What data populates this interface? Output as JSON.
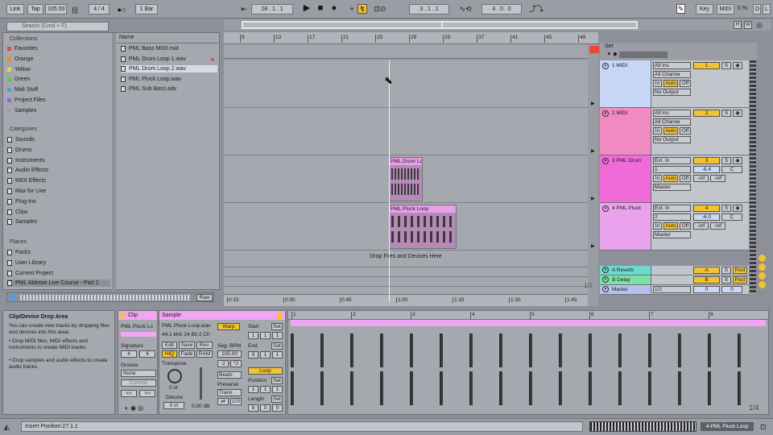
{
  "topbar": {
    "link": "Link",
    "tap": "Tap",
    "tempo": "105.00",
    "signature": "4 / 4",
    "quantize": "1 Bar",
    "arrangement_position": "28 . 1 . 1",
    "loop_start": "3 . 1 . 1",
    "loop_length": "4 . 0 . 0",
    "key": "Key",
    "midi": "MIDI",
    "cpu": "0 %",
    "disk_label": "D",
    "letter_l": "L"
  },
  "browser": {
    "search_placeholder": "Search (Cmd + F)",
    "collections_header": "Collections",
    "collections": [
      {
        "label": "Favorites",
        "color": "#e5484d"
      },
      {
        "label": "Orange",
        "color": "#f18a1e"
      },
      {
        "label": "Yellow",
        "color": "#f0d33b"
      },
      {
        "label": "Green",
        "color": "#5fc45c"
      },
      {
        "label": "Midi Stuff",
        "color": "#5a9be0"
      },
      {
        "label": "Project Files",
        "color": "#9a62d9"
      },
      {
        "label": "Samples",
        "color": "#9da0a8"
      }
    ],
    "categories_header": "Categories",
    "categories": [
      "Sounds",
      "Drums",
      "Instruments",
      "Audio Effects",
      "MIDI Effects",
      "Max for Live",
      "Plug-Ins",
      "Clips",
      "Samples"
    ],
    "places_header": "Places",
    "places": [
      "Packs",
      "User Library",
      "Current Project",
      "PML Ableton Live Course - Part 1"
    ],
    "name_header": "Name",
    "files": [
      "PML Bass MIDI.mid",
      "PML Drum Loop 1.wav",
      "PML Drum Loop 2.wav",
      "PML Pluck Loop.wav",
      "PML Sub Bass.adv"
    ],
    "raw": "Raw"
  },
  "arrangement": {
    "bar_numbers": [
      "9",
      "13",
      "17",
      "21",
      "25",
      "29",
      "33",
      "37",
      "41",
      "45",
      "49"
    ],
    "time_labels": [
      "0:15",
      "0:30",
      "0:45",
      "1:00",
      "1:15",
      "1:30",
      "1:45"
    ],
    "drop_text": "Drop Files and Devices Here",
    "zoom": "1/1",
    "set_label": "Set",
    "clips": [
      "PML Drum Lo",
      "PML Pluck Loop"
    ]
  },
  "tracks": [
    {
      "name": "1 MIDI",
      "color": "#c6d6f7",
      "input": "All Ins",
      "channel": "All Channe",
      "output": "No Output",
      "number": "1",
      "type": "midi"
    },
    {
      "name": "2 MIDI",
      "color": "#f08ac0",
      "input": "All Ins",
      "channel": "All Channe",
      "output": "No Output",
      "number": "2",
      "type": "midi"
    },
    {
      "name": "3 PML Drum",
      "color": "#f06ad8",
      "input": "Ext. In",
      "channel": "1",
      "output": "Master",
      "number": "3",
      "vol": "-6.4",
      "pan": "C",
      "peak1": "-inf",
      "peak2": "-inf",
      "type": "audio"
    },
    {
      "name": "4 PML Pluck",
      "color": "#e9a2ec",
      "input": "Ext. In",
      "channel": "2",
      "output": "Master",
      "number": "4",
      "vol": "-6.0",
      "pan": "C",
      "peak1": "-inf",
      "peak2": "-inf",
      "type": "audio"
    }
  ],
  "returns": [
    {
      "name": "A Reverb",
      "color": "#6fd8cf",
      "letter": "A",
      "post": "Post"
    },
    {
      "name": "B Delay",
      "color": "#7ee0a5",
      "letter": "B",
      "post": "Post"
    },
    {
      "name": "Master",
      "color": "#b6c0f0",
      "output": "1/2",
      "value": "0",
      "value2": "0"
    }
  ],
  "io": {
    "in": "In",
    "auto": "Auto",
    "off": "Off",
    "s": "S"
  },
  "info": {
    "title": "Clip/Device Drop Area",
    "text": "You can create new tracks by dropping files and devices into this area:",
    "bullets": [
      "Drop MIDI files, MIDI effects and instruments to create MIDI tracks.",
      "Drop samples and audio effects to create audio tracks."
    ]
  },
  "clipview": {
    "clip_tab": "Clip",
    "clip_name": "PML Pluck Lo",
    "signature_label": "Signature",
    "sig_num": "4",
    "sig_den": "4",
    "groove_label": "Groove",
    "groove": "None",
    "commit": "Commit"
  },
  "sample": {
    "tab": "Sample",
    "file": "PML Pluck Loop.wav",
    "info": "44.1 kHz 24 Bit 2 Ch",
    "warp": "Warp",
    "edit": "Edit",
    "save": "Save",
    "rev": "Rev.",
    "hiq": "HiQ",
    "fade": "Fade",
    "ram": "RAM",
    "transpose": "Transpose",
    "transpose_val": "0 st",
    "detune": "Detune",
    "detune_val": "0 ct",
    "gain": "0.00 dB",
    "seg_bpm": "Seg. BPM",
    "bpm": "105.00",
    "half": ":2",
    "double": "*2",
    "beats": "Beats",
    "preserve": "Preserve",
    "trans": "Trans",
    "num100": "100",
    "start": "Start",
    "end": "End",
    "set": "Set",
    "loop": "Loop",
    "position": "Position",
    "length": "Length",
    "start_vals": [
      "1",
      "1",
      "1"
    ],
    "end_vals": [
      "9",
      "1",
      "1"
    ],
    "pos_vals": [
      "1",
      "1",
      "1"
    ],
    "len_vals": [
      "8",
      "0",
      "0"
    ],
    "ruler": [
      "1",
      "2",
      "3",
      "4",
      "5",
      "6",
      "7",
      "8"
    ],
    "zoom": "1/4"
  },
  "status": {
    "insert": "Insert Position:27.1.1",
    "track": "4-PML Pluck Loop"
  }
}
